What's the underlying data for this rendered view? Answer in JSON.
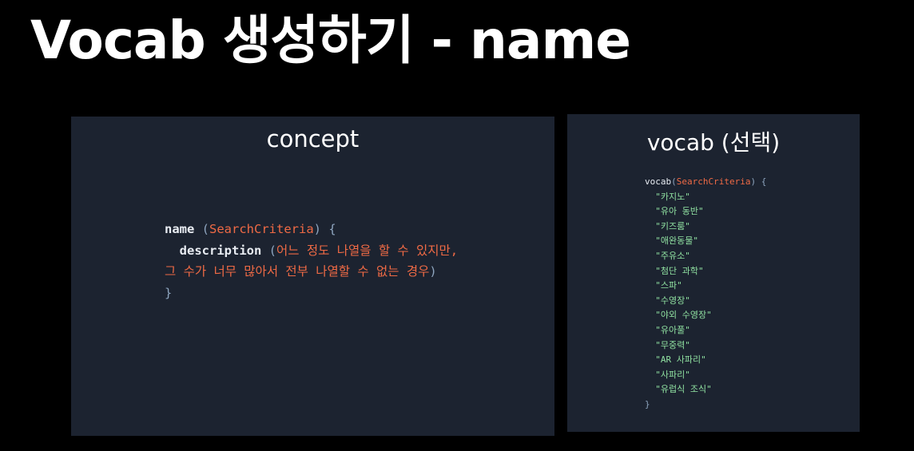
{
  "slide": {
    "title": "Vocab 생성하기 - name"
  },
  "concept": {
    "title": "concept",
    "code": {
      "keyword": "name",
      "open_paren": "(",
      "type": "SearchCriteria",
      "close_paren_brace": ") {",
      "desc_keyword": "description",
      "desc_open": "(",
      "desc_text_1": "어느 정도 나열을 할 수 있지만,",
      "desc_text_2": "그 수가 너무 많아서 전부 나열할 수 없는 경우",
      "desc_close": ")",
      "close_brace": "}"
    }
  },
  "vocab": {
    "title": "vocab (선택)",
    "keyword": "vocab",
    "open_paren": "(",
    "type": "SearchCriteria",
    "close_paren_brace": ") {",
    "items": [
      "\"카지노\"",
      "\"유아 동반\"",
      "\"키즈룸\"",
      "\"애완동물\"",
      "\"주유소\"",
      "\"첨단 과학\"",
      "\"스파\"",
      "\"수영장\"",
      "\"야외 수영장\"",
      "\"유아풀\"",
      "\"무중력\"",
      "\"AR 사파리\"",
      "\"사파리\"",
      "\"유럽식 조식\""
    ],
    "close_brace": "}"
  },
  "colors": {
    "background": "#000000",
    "panel": "#1c2330",
    "type_accent": "#ef6a45",
    "string_green": "#8fe0a0",
    "punctuation": "#8ea5bf"
  }
}
